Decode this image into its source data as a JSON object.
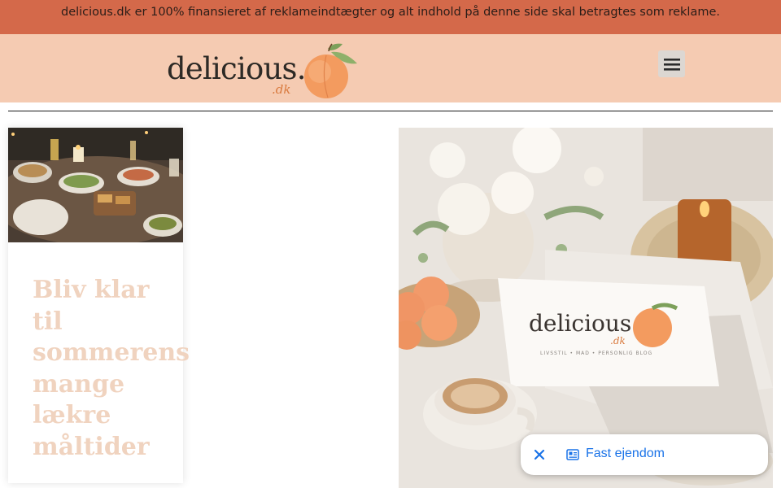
{
  "banner": {
    "text": "delicious.dk er 100% finansieret af reklameindtægter og alt indhold på denne side skal betragtes som reklame."
  },
  "header": {
    "logo": {
      "word": "delicious.",
      "tld": ".dk"
    },
    "menu_icon": "hamburger-menu-icon"
  },
  "post": {
    "title": "Bliv klar til sommerens mange lækre måltider",
    "image": "outdoor-dinner-table-photo"
  },
  "hero": {
    "image": "flowers-peaches-coffee-book-photo",
    "card_word": "delicious.",
    "card_tld": ".dk",
    "card_tagline": "LIVSSTIL • MAD • PERSONLIG BLOG"
  },
  "chip": {
    "label": "Fast ejendom",
    "close_icon": "close-icon",
    "icon": "newspaper-icon"
  },
  "colors": {
    "banner_bg": "#d4694a",
    "header_bg": "#f5cbb2",
    "post_title": "#f0d3bf",
    "chip_text": "#1a73e8",
    "logo_tld": "#d97a3e"
  }
}
